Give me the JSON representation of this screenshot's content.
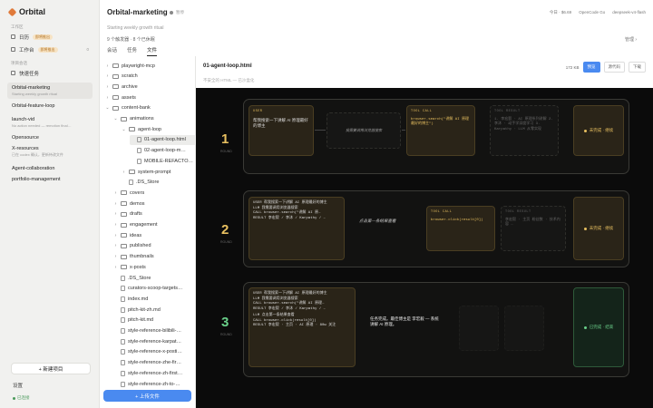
{
  "app": {
    "name": "Orbital"
  },
  "sidebar": {
    "section_work": "工作区",
    "items": [
      {
        "label": "日历",
        "badge": "即将推出"
      },
      {
        "label": "工作台",
        "badge": "即将推出",
        "count": "0"
      }
    ],
    "section_projects": "项目会话",
    "quick_task": "快速任务",
    "projects": [
      {
        "title": "Orbital-marketing",
        "sub": "Starting weekly growth ritual"
      },
      {
        "title": "Orbital-feature-loop",
        "sub": ""
      },
      {
        "title": "launch-vid",
        "sub": "No action needed — remotion final…"
      },
      {
        "title": "Opensource",
        "sub": ""
      },
      {
        "title": "X-resources",
        "sub": "已在 codex 确认，更新待改文件"
      },
      {
        "title": "Agent-collaboration",
        "sub": ""
      },
      {
        "title": "portfolio-management",
        "sub": ""
      }
    ],
    "new_project": "+ 新建项目",
    "settings": "设置",
    "connected": "已连接"
  },
  "header": {
    "title": "Orbital-marketing",
    "tag": "暂停",
    "stats": [
      "今日 · $6.69",
      "OpenCode Go",
      "deepseek-v4-flash"
    ],
    "subtitle": "Starting weekly growth ritual",
    "messages": "9 个触发器 · 8 个已休眠",
    "manage": "管理 ›",
    "tabs": [
      "会话",
      "任务",
      "文件"
    ]
  },
  "files": [
    {
      "name": "playwright-mcp",
      "type": "folder",
      "depth": 0
    },
    {
      "name": "scratch",
      "type": "folder",
      "depth": 0
    },
    {
      "name": "archive",
      "type": "folder",
      "depth": 0
    },
    {
      "name": "assets",
      "type": "folder",
      "depth": 0
    },
    {
      "name": "content-bank",
      "type": "folder",
      "depth": 0,
      "open": true
    },
    {
      "name": "animations",
      "type": "folder",
      "depth": 1,
      "open": true
    },
    {
      "name": "agent-loop",
      "type": "folder",
      "depth": 2,
      "open": true
    },
    {
      "name": "01-agent-loop.html",
      "type": "file",
      "depth": 3,
      "selected": true
    },
    {
      "name": "02-agent-loop-m…",
      "type": "file",
      "depth": 3
    },
    {
      "name": "MOBILE-REFACTO…",
      "type": "file",
      "depth": 3
    },
    {
      "name": "system-prompt",
      "type": "folder",
      "depth": 2
    },
    {
      "name": ".DS_Store",
      "type": "file",
      "depth": 2
    },
    {
      "name": "covers",
      "type": "folder",
      "depth": 1
    },
    {
      "name": "demos",
      "type": "folder",
      "depth": 1
    },
    {
      "name": "drafts",
      "type": "folder",
      "depth": 1
    },
    {
      "name": "engagement",
      "type": "folder",
      "depth": 1
    },
    {
      "name": "ideas",
      "type": "folder",
      "depth": 1
    },
    {
      "name": "published",
      "type": "folder",
      "depth": 1
    },
    {
      "name": "thumbnails",
      "type": "folder",
      "depth": 1
    },
    {
      "name": "x-posts",
      "type": "folder",
      "depth": 1
    },
    {
      "name": ".DS_Store",
      "type": "file",
      "depth": 1
    },
    {
      "name": "curators-scoop-targets…",
      "type": "file",
      "depth": 1
    },
    {
      "name": "index.md",
      "type": "file",
      "depth": 1
    },
    {
      "name": "pitch-kit-zh.md",
      "type": "file",
      "depth": 1
    },
    {
      "name": "pitch-kit.md",
      "type": "file",
      "depth": 1
    },
    {
      "name": "style-reference-bilibili-…",
      "type": "file",
      "depth": 1
    },
    {
      "name": "style-reference-karpat…",
      "type": "file",
      "depth": 1
    },
    {
      "name": "style-reference-x-posti…",
      "type": "file",
      "depth": 1
    },
    {
      "name": "style-reference-zhe-fir…",
      "type": "file",
      "depth": 1
    },
    {
      "name": "style-reference-zh-first…",
      "type": "file",
      "depth": 1
    },
    {
      "name": "style-reference-zh-to-…",
      "type": "file",
      "depth": 1
    }
  ],
  "upload": "+ 上传文件",
  "preview": {
    "title": "01-agent-loop.html",
    "size": "172 KB",
    "buttons": [
      "预览",
      "源代码",
      "下载"
    ],
    "note": "不安全的 HTML — 已沙盒化"
  },
  "loop": [
    {
      "num": "1",
      "sub": "ROUND",
      "user_label": "USER",
      "user_text": "帮我搜索一下讲解 AI 原理最好的博主",
      "mid": "我需要调用浏览器搜索",
      "tool_label": "TOOL CALL",
      "tool_text": "browser.search(\"讲解 AI 原理最好的博主\")",
      "result_label": "TOOL RESULT",
      "result_text": "1. 李宏毅 · AI 原理系列讲解 2. 李沐 · 动手学深度学习 3. Karpathy · LLM 从零实现",
      "status": "未完成 · 继续"
    },
    {
      "num": "2",
      "sub": "ROUND",
      "ctx": [
        "USER 帮我搜索一下讲解 AI 原理最好的博主",
        "LLM 我需要调用浏览器搜索",
        "CALL browser.search(\"讲解 AI 原…",
        "RESULT 李宏毅 / 李沐 / Karpathy / …"
      ],
      "mid": "点击第一条结果查看",
      "tool_label": "TOOL CALL",
      "tool_text": "browser.click(result[0])",
      "result_label": "TOOL RESULT",
      "result_text": "李宏毅 · 主页 粉丝数 · 技术内容 …",
      "status": "未完成 · 继续"
    },
    {
      "num": "3",
      "sub": "ROUND",
      "ctx": [
        "USER 帮我搜索一下讲解 AI 原理最好的博主",
        "LLM 我需要调用浏览器搜索",
        "CALL browser.search(\"讲解 AI 原理…",
        "RESULT 李宏毅 / 李沐 / Karpathy / …",
        "LLM 点击第一条结果查看",
        "CALL browser.click(result[0])",
        "RESULT 李宏毅 · 主页 · AI 原理 · 80w 关注"
      ],
      "mid": "任务完成。最佳博主是 李宏毅 — 系统讲解 AI 原理。",
      "status": "已完成 · 结束"
    }
  ]
}
